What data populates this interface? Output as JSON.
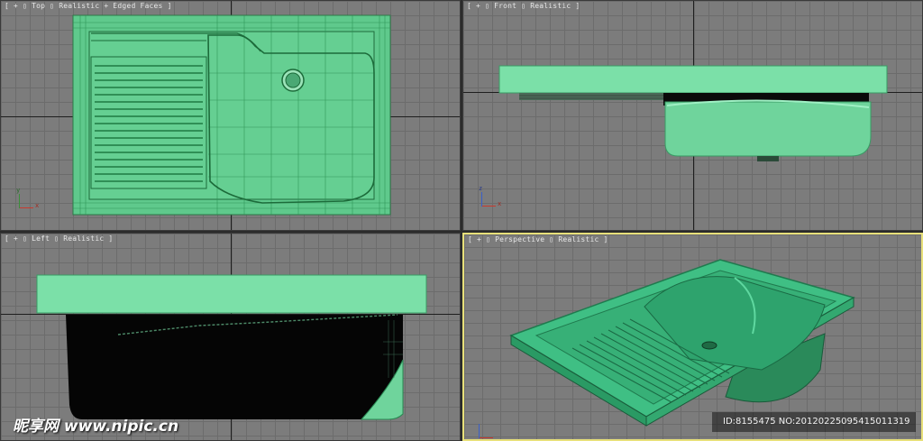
{
  "viewports": {
    "top": {
      "label": "[ + ▯ Top ▯ Realistic + Edged Faces ]"
    },
    "front": {
      "label": "[ + ▯ Front ▯ Realistic ]"
    },
    "left": {
      "label": "[ + ▯ Left ▯ Realistic ]"
    },
    "perspective": {
      "label": "[ + ▯ Perspective ▯ Realistic ]"
    }
  },
  "axes": {
    "x": "x",
    "y": "y",
    "z": "z"
  },
  "watermark": {
    "text": "昵享网 www.nipic.cn"
  },
  "image_id": {
    "text": "ID:8155475 NO:20120225095415011319"
  },
  "colors": {
    "model": "#6fd49c",
    "model_wire": "#2b9b5c",
    "viewport_bg": "#7c7c7c",
    "active_border": "#e8e07a"
  },
  "icons": [
    "axis-gizmo-icon"
  ]
}
